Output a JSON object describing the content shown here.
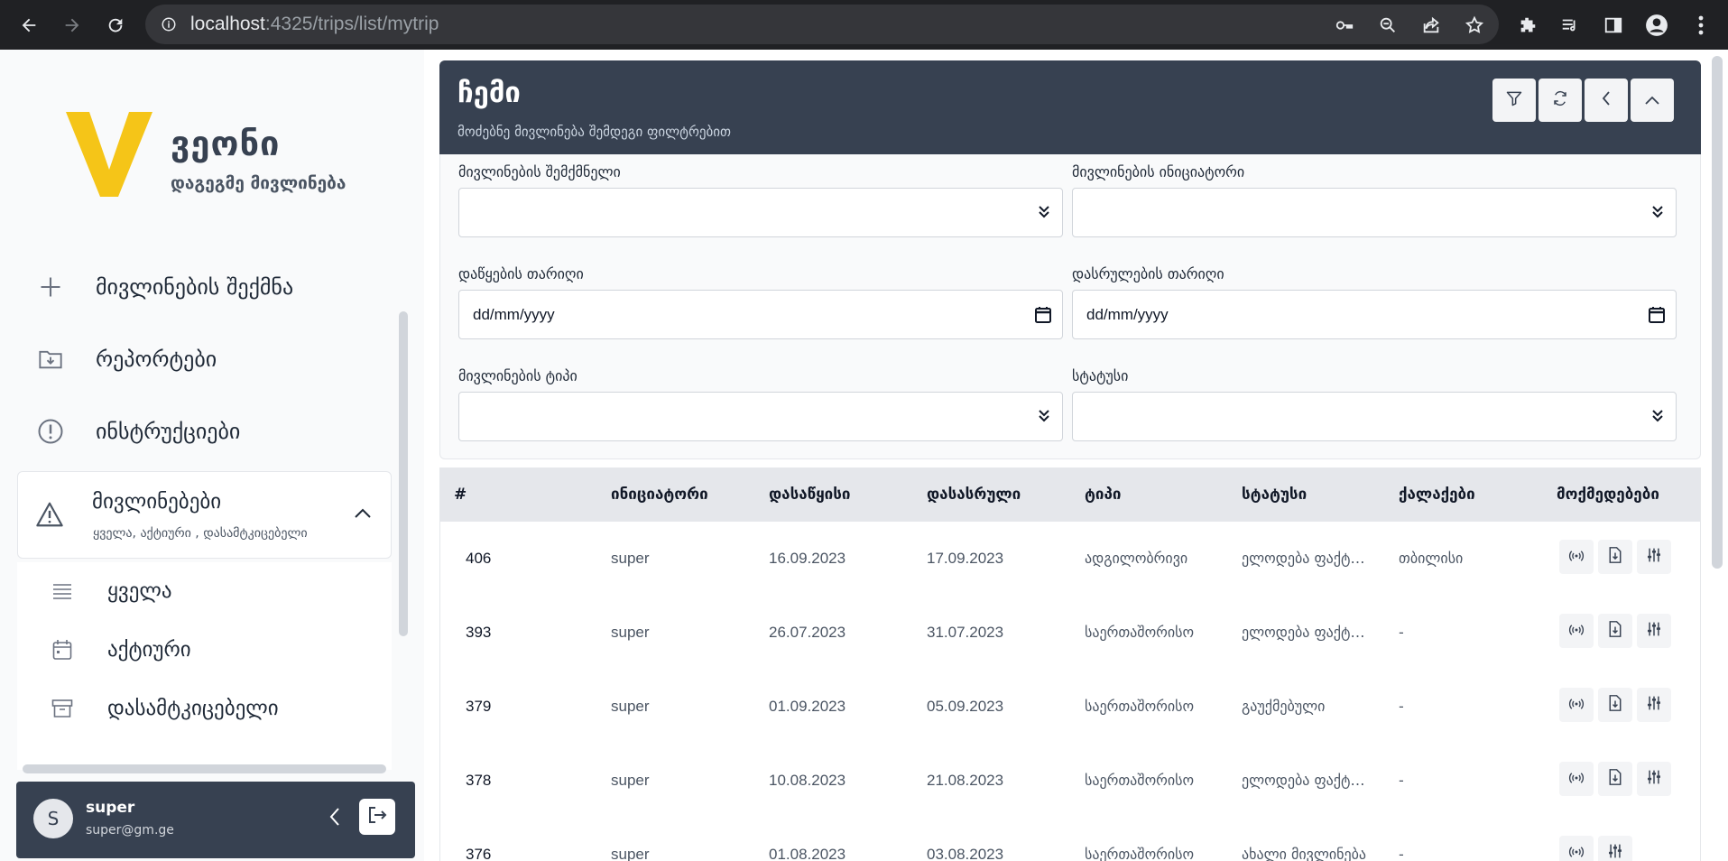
{
  "browser": {
    "url_host": "localhost",
    "url_path": ":4325/trips/list/mytrip"
  },
  "brand": {
    "name": "ვეონი",
    "subtitle": "დაგეგმე მივლინება",
    "accent": "#f5c518"
  },
  "sidebar": {
    "items": [
      {
        "label": "მივლინების შექმნა",
        "icon": "plus-icon"
      },
      {
        "label": "რეპორტები",
        "icon": "folder-download-icon"
      },
      {
        "label": "ინსტრუქციები",
        "icon": "alert-circle-icon"
      }
    ],
    "group": {
      "label": "მივლინებები",
      "sublabel": "ყველა, აქტიური , დასამტკიცებელი",
      "icon": "warning-triangle-icon",
      "children": [
        {
          "label": "ყველა",
          "icon": "list-icon"
        },
        {
          "label": "აქტიური",
          "icon": "calendar-icon"
        },
        {
          "label": "დასამტკიცებელი",
          "icon": "archive-icon"
        }
      ]
    }
  },
  "user": {
    "initial": "S",
    "name": "super",
    "email": "super@gm.ge"
  },
  "header": {
    "title": "ჩემი",
    "subtitle": "მოძებნე მივლინება შემდეგი ფილტრებით"
  },
  "filters": {
    "creator_label": "მივლინების შემქმნელი",
    "initiator_label": "მივლინების ინიციატორი",
    "start_label": "დაწყების თარიღი",
    "start_value": "dd/mm/yyyy",
    "end_label": "დასრულების თარიღი",
    "end_value": "dd/mm/yyyy",
    "type_label": "მივლინების ტიპი",
    "status_label": "სტატუსი"
  },
  "table": {
    "headers": [
      "#",
      "ინიციატორი",
      "დასაწყისი",
      "დასასრული",
      "ტიპი",
      "სტატუსი",
      "ქალაქები",
      "მოქმედებები"
    ],
    "rows": [
      {
        "id": "406",
        "initiator": "super",
        "start": "16.09.2023",
        "end": "17.09.2023",
        "type": "ადგილობრივი",
        "status": "ელოდება ფაქტობრივ",
        "cities": "თბილისი"
      },
      {
        "id": "393",
        "initiator": "super",
        "start": "26.07.2023",
        "end": "31.07.2023",
        "type": "საერთაშორისო",
        "status": "ელოდება ფაქტობრივ",
        "cities": "-"
      },
      {
        "id": "379",
        "initiator": "super",
        "start": "01.09.2023",
        "end": "05.09.2023",
        "type": "საერთაშორისო",
        "status": "გაუქმებული",
        "cities": "-"
      },
      {
        "id": "378",
        "initiator": "super",
        "start": "10.08.2023",
        "end": "21.08.2023",
        "type": "საერთაშორისო",
        "status": "ელოდება ფაქტობრივ",
        "cities": "-"
      },
      {
        "id": "376",
        "initiator": "super",
        "start": "01.08.2023",
        "end": "03.08.2023",
        "type": "საერთაშორისო",
        "status": "ახალი მივლინება",
        "cities": "-"
      }
    ]
  }
}
